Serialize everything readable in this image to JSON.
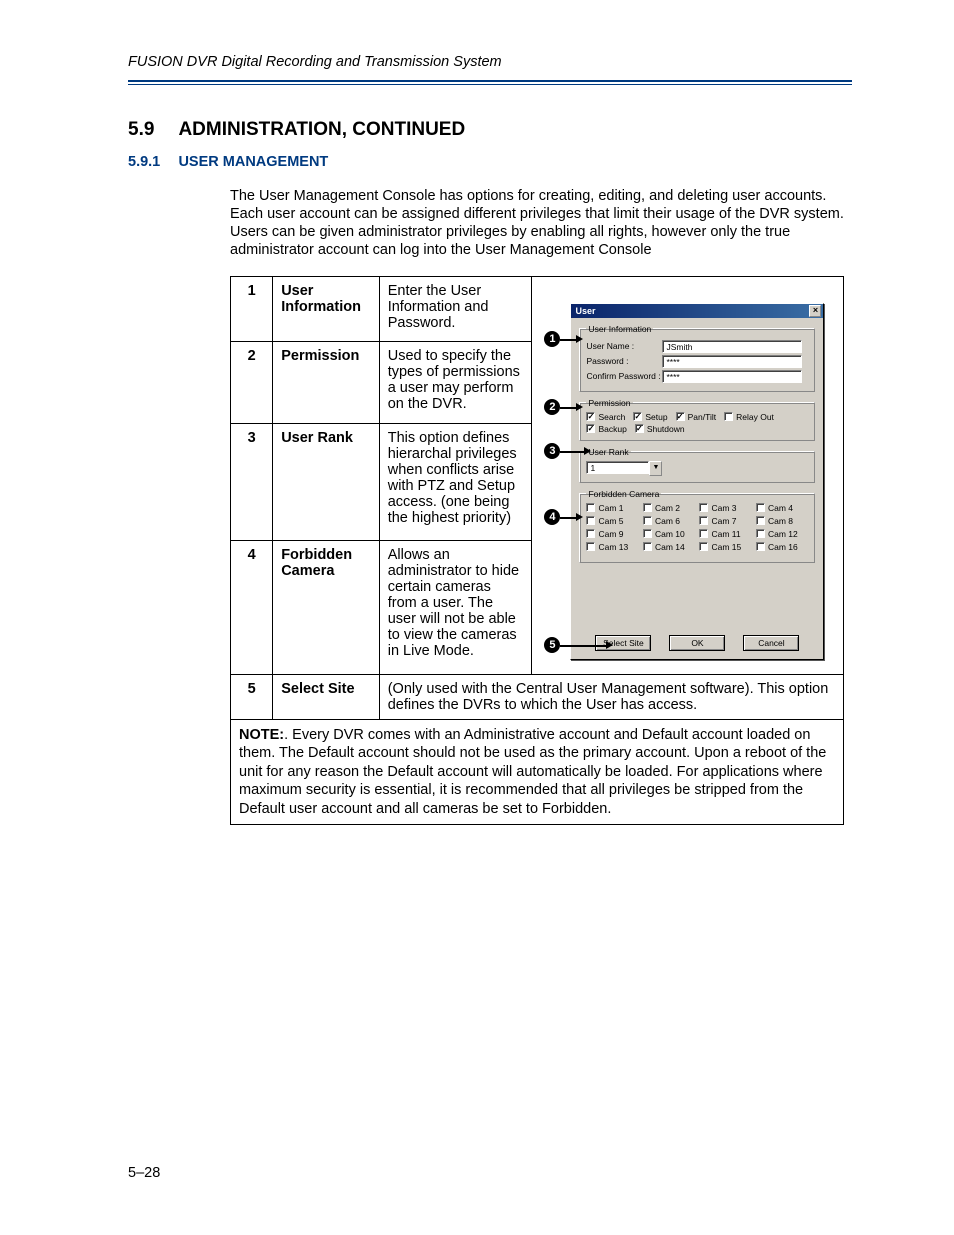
{
  "header": {
    "running": "FUSION DVR Digital Recording and Transmission System"
  },
  "section": {
    "num": "5.9",
    "title": "ADMINISTRATION, CONTINUED"
  },
  "subsection": {
    "num": "5.9.1",
    "title": "USER MANAGEMENT"
  },
  "intro": "The User Management Console has options for creating, editing, and deleting user accounts. Each user account can be assigned different privileges that limit their usage of the DVR system. Users can be given administrator privileges by enabling all rights, however only the true administrator account can log into the User Management Console",
  "rows": [
    {
      "n": "1",
      "name_line1": "User",
      "name_line2": "Information",
      "desc": "Enter the User Information and Password."
    },
    {
      "n": "2",
      "name_line1": "Permission",
      "name_line2": "",
      "desc": "Used to specify the types of permissions a user may perform on the DVR."
    },
    {
      "n": "3",
      "name_line1": "User Rank",
      "name_line2": "",
      "desc": "This option defines hierarchal privileges when conflicts arise with PTZ and Setup access. (one being the highest priority)"
    },
    {
      "n": "4",
      "name_line1": "Forbidden",
      "name_line2": "Camera",
      "desc": "Allows an administrator to hide certain cameras from a user. The user will not be able to view the cameras in Live Mode."
    },
    {
      "n": "5",
      "name_line1": "Select Site",
      "name_line2": "",
      "desc_full": "(Only used with the Central User Management software). This option defines the DVRs to which the User has access."
    }
  ],
  "note": {
    "label": "NOTE:",
    "text": ". Every DVR comes with an Administrative account and Default account loaded on them. The Default account should not be used as the primary account. Upon a reboot of the unit for any reason the Default account will automatically be loaded. For applications where maximum security is essential, it is recommended that all privileges be stripped from the Default user account and all cameras be set to Forbidden."
  },
  "dialog": {
    "title": "User",
    "user_info_legend": "User Information",
    "username_label": "User Name :",
    "username_value": "JSmith",
    "password_label": "Password :",
    "password_value": "****",
    "confirm_label": "Confirm Password :",
    "confirm_value": "****",
    "permission_legend": "Permission",
    "perms": [
      {
        "label": "Search",
        "checked": true
      },
      {
        "label": "Setup",
        "checked": true
      },
      {
        "label": "Pan/Tilt",
        "checked": true
      },
      {
        "label": "Relay Out",
        "checked": false
      },
      {
        "label": "Backup",
        "checked": true
      },
      {
        "label": "Shutdown",
        "checked": true
      }
    ],
    "rank_legend": "User Rank",
    "rank_value": "1",
    "forbidden_legend": "Forbidden Camera",
    "cams": [
      "Cam 1",
      "Cam 2",
      "Cam 3",
      "Cam 4",
      "Cam 5",
      "Cam 6",
      "Cam 7",
      "Cam 8",
      "Cam 9",
      "Cam 10",
      "Cam 11",
      "Cam 12",
      "Cam 13",
      "Cam 14",
      "Cam 15",
      "Cam 16"
    ],
    "btn_select_site": "Select Site",
    "btn_ok": "OK",
    "btn_cancel": "Cancel"
  },
  "callouts": [
    "1",
    "2",
    "3",
    "4",
    "5"
  ],
  "footer": "5–28"
}
